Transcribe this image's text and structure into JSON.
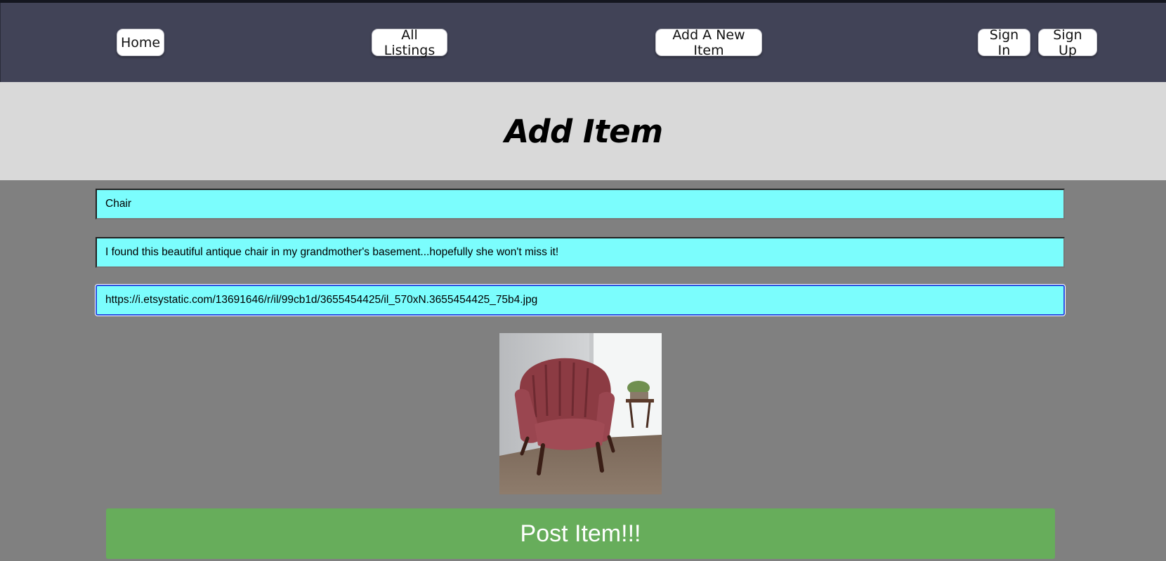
{
  "nav": {
    "home": "Home",
    "all_listings": "All Listings",
    "add_new_item": "Add A New Item",
    "sign_in": "Sign In",
    "sign_up": "Sign Up"
  },
  "header": {
    "title": "Add Item"
  },
  "form": {
    "name_value": "Chair",
    "description_value": "I found this beautiful antique chair in my grandmother's basement...hopefully she won't miss it!",
    "image_url_value": "https://i.etsystatic.com/13691646/r/il/99cb1d/3655454425/il_570xN.3655454425_75b4.jpg",
    "submit_label": "Post Item!!!"
  },
  "colors": {
    "navbar_bg": "#414357",
    "header_bg": "#d9d9d9",
    "page_bg": "#808080",
    "input_bg": "#7bfdfd",
    "submit_bg": "#67ad5b"
  }
}
